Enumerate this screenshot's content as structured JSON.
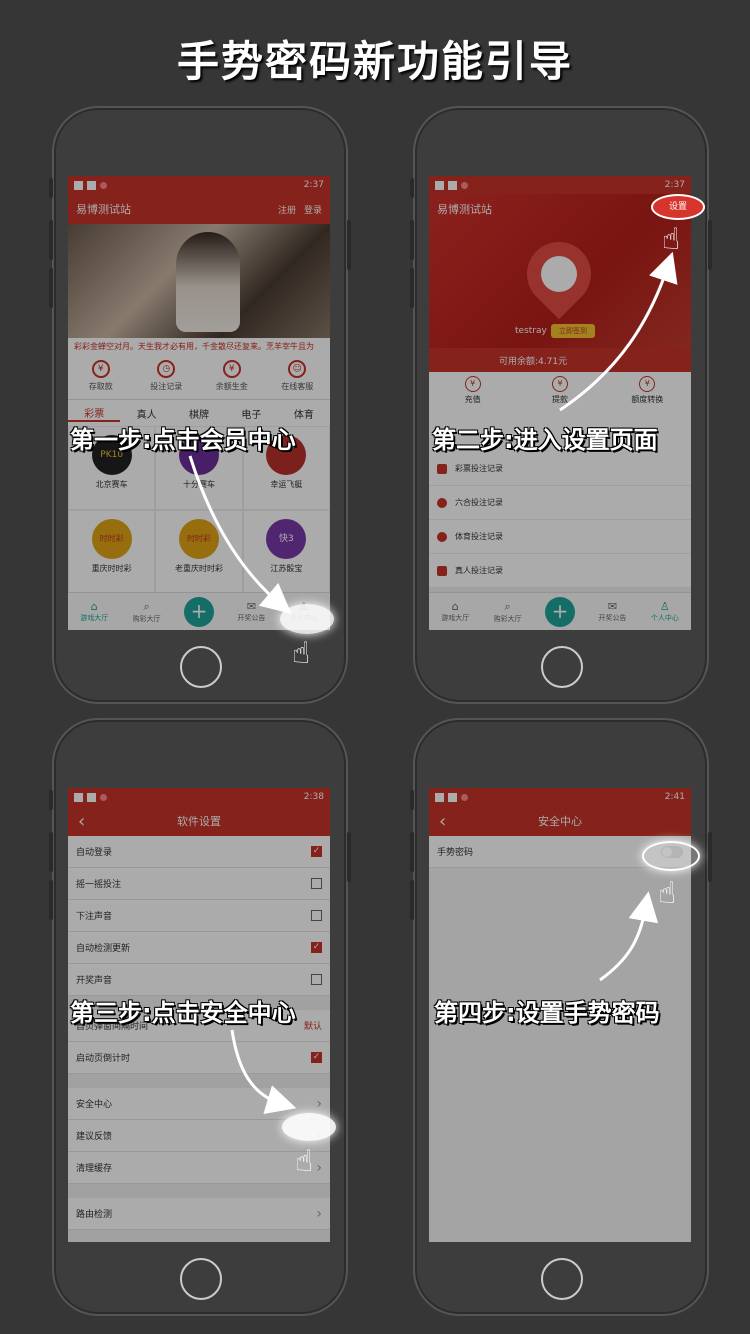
{
  "title": "手势密码新功能引导",
  "steps": [
    "第一步:点击会员中心",
    "第二步:进入设置页面",
    "第三步:点击安全中心",
    "第四步:设置手势密码"
  ],
  "phone1": {
    "time": "2:37",
    "app_title": "易博测试站",
    "register": "注册",
    "login": "登录",
    "marquee": "彩彩金蝉空对月。天生我才必有用，千金散尽还复来。烹羊宰牛且为",
    "quick": [
      "存取款",
      "投注记录",
      "余额生金",
      "在线客服"
    ],
    "quick_icons": [
      "¥",
      "◷",
      "¥",
      "☺"
    ],
    "categories": [
      "彩票",
      "真人",
      "棋牌",
      "电子",
      "体育"
    ],
    "games": [
      "北京赛车",
      "十分赛车",
      "幸运飞艇",
      "重庆时时彩",
      "老重庆时时彩",
      "江苏骰宝"
    ],
    "game_logo_texts": [
      "PK10",
      "",
      "",
      "时时彩",
      "时时彩",
      "快3"
    ]
  },
  "tabbar": {
    "hall": "游戏大厅",
    "buy": "购彩大厅",
    "notice": "开奖公告",
    "member": "个人中心",
    "plus": "+"
  },
  "phone2": {
    "time": "2:37",
    "app_title": "易博测试站",
    "settings": "设置",
    "username": "testray",
    "signin": "立即签到",
    "balance": "可用余额:4.71元",
    "fin": [
      "充值",
      "提款",
      "额度转换"
    ],
    "records": [
      "彩票投注记录",
      "六合投注记录",
      "体育投注记录",
      "真人投注记录"
    ]
  },
  "phone3": {
    "time": "2:38",
    "title": "软件设置",
    "rows": [
      {
        "label": "自动登录",
        "checked": true
      },
      {
        "label": "摇一摇投注",
        "checked": false
      },
      {
        "label": "下注声音",
        "checked": false
      },
      {
        "label": "自动检测更新",
        "checked": true
      },
      {
        "label": "开奖声音",
        "checked": false
      }
    ],
    "popup_label": "首页弹窗间隔时间",
    "popup_value": "默认",
    "countdown_label": "启动页倒计时",
    "links": [
      "安全中心",
      "建议反馈",
      "清理缓存"
    ],
    "route": "路由检测",
    "check_mark": "✓",
    "chevron": "›"
  },
  "phone4": {
    "time": "2:41",
    "title": "安全中心",
    "gesture": "手势密码",
    "back": "‹"
  },
  "icons": {
    "hand": "☝",
    "back": "‹"
  },
  "colors": {
    "brand_red": "#c63329",
    "teal": "#1fa59a",
    "background": "#363636"
  }
}
